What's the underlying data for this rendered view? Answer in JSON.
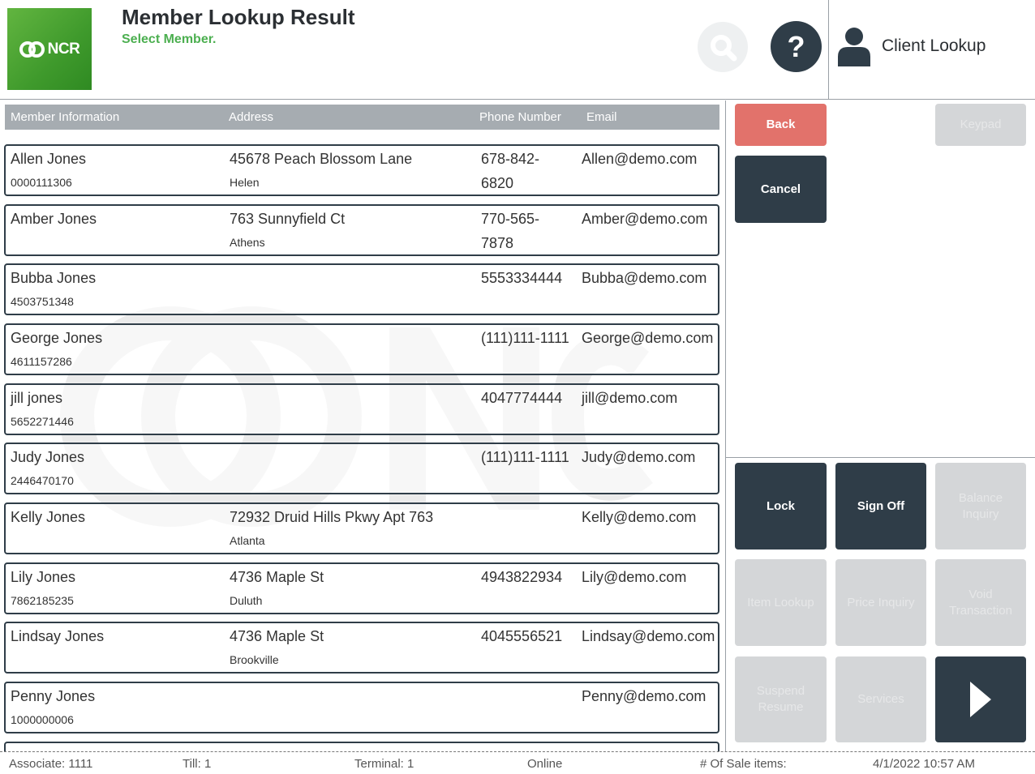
{
  "header": {
    "logo_text": "NCR",
    "title": "Member Lookup Result",
    "subtitle": "Select Member.",
    "client_lookup_label": "Client Lookup",
    "help_glyph": "?"
  },
  "table": {
    "columns": [
      "Member Information",
      "Address",
      "Phone Number",
      "Email"
    ],
    "rows": [
      {
        "name": "Allen Jones",
        "id": "0000111306",
        "address": "45678 Peach Blossom Lane",
        "city": "Helen",
        "phone": "678-842-6820",
        "email": "Allen@demo.com"
      },
      {
        "name": "Amber Jones",
        "id": "",
        "address": "763 Sunnyfield Ct",
        "city": "Athens",
        "phone": "770-565-7878",
        "email": "Amber@demo.com"
      },
      {
        "name": "Bubba Jones",
        "id": "4503751348",
        "address": "",
        "city": "",
        "phone": "5553334444",
        "email": "Bubba@demo.com"
      },
      {
        "name": "George Jones",
        "id": "4611157286",
        "address": "",
        "city": "",
        "phone": "(111)111-1111",
        "email": "George@demo.com"
      },
      {
        "name": "jill jones",
        "id": "5652271446",
        "address": "",
        "city": "",
        "phone": "4047774444",
        "email": "jill@demo.com"
      },
      {
        "name": "Judy Jones",
        "id": "2446470170",
        "address": "",
        "city": "",
        "phone": "(111)111-1111",
        "email": "Judy@demo.com"
      },
      {
        "name": "Kelly Jones",
        "id": "",
        "address": "72932 Druid Hills Pkwy Apt 763",
        "city": "Atlanta",
        "phone": "",
        "email": "Kelly@demo.com"
      },
      {
        "name": "Lily Jones",
        "id": "7862185235",
        "address": "4736 Maple St",
        "city": "Duluth",
        "phone": "4943822934",
        "email": "Lily@demo.com"
      },
      {
        "name": "Lindsay Jones",
        "id": "",
        "address": "4736 Maple St",
        "city": "Brookville",
        "phone": "4045556521",
        "email": "Lindsay@demo.com"
      },
      {
        "name": "Penny Jones",
        "id": "1000000006",
        "address": "",
        "city": "",
        "phone": "",
        "email": "Penny@demo.com"
      }
    ]
  },
  "buttons": {
    "back": "Back",
    "keypad": "Keypad",
    "cancel": "Cancel",
    "lock": "Lock",
    "sign_off": "Sign Off",
    "balance_inquiry": "Balance Inquiry",
    "item_lookup": "Item Lookup",
    "price_inquiry": "Price Inquiry",
    "void_transaction": "Void Transaction",
    "suspend_resume": "Suspend Resume",
    "services": "Services"
  },
  "footer": {
    "associate": "Associate: 1111",
    "till": "Till: 1",
    "terminal": "Terminal: 1",
    "status": "Online",
    "sale_items": "# Of Sale items:",
    "datetime": "4/1/2022 10:57 AM"
  },
  "icons": {
    "search": "search-icon",
    "help": "help-icon",
    "user": "user-icon",
    "next": "chevron-right-icon"
  },
  "colors": {
    "brand_green": "#4caf50",
    "dark": "#2f3d48",
    "back_red": "#e2726b",
    "disabled": "#d4d6d8"
  }
}
